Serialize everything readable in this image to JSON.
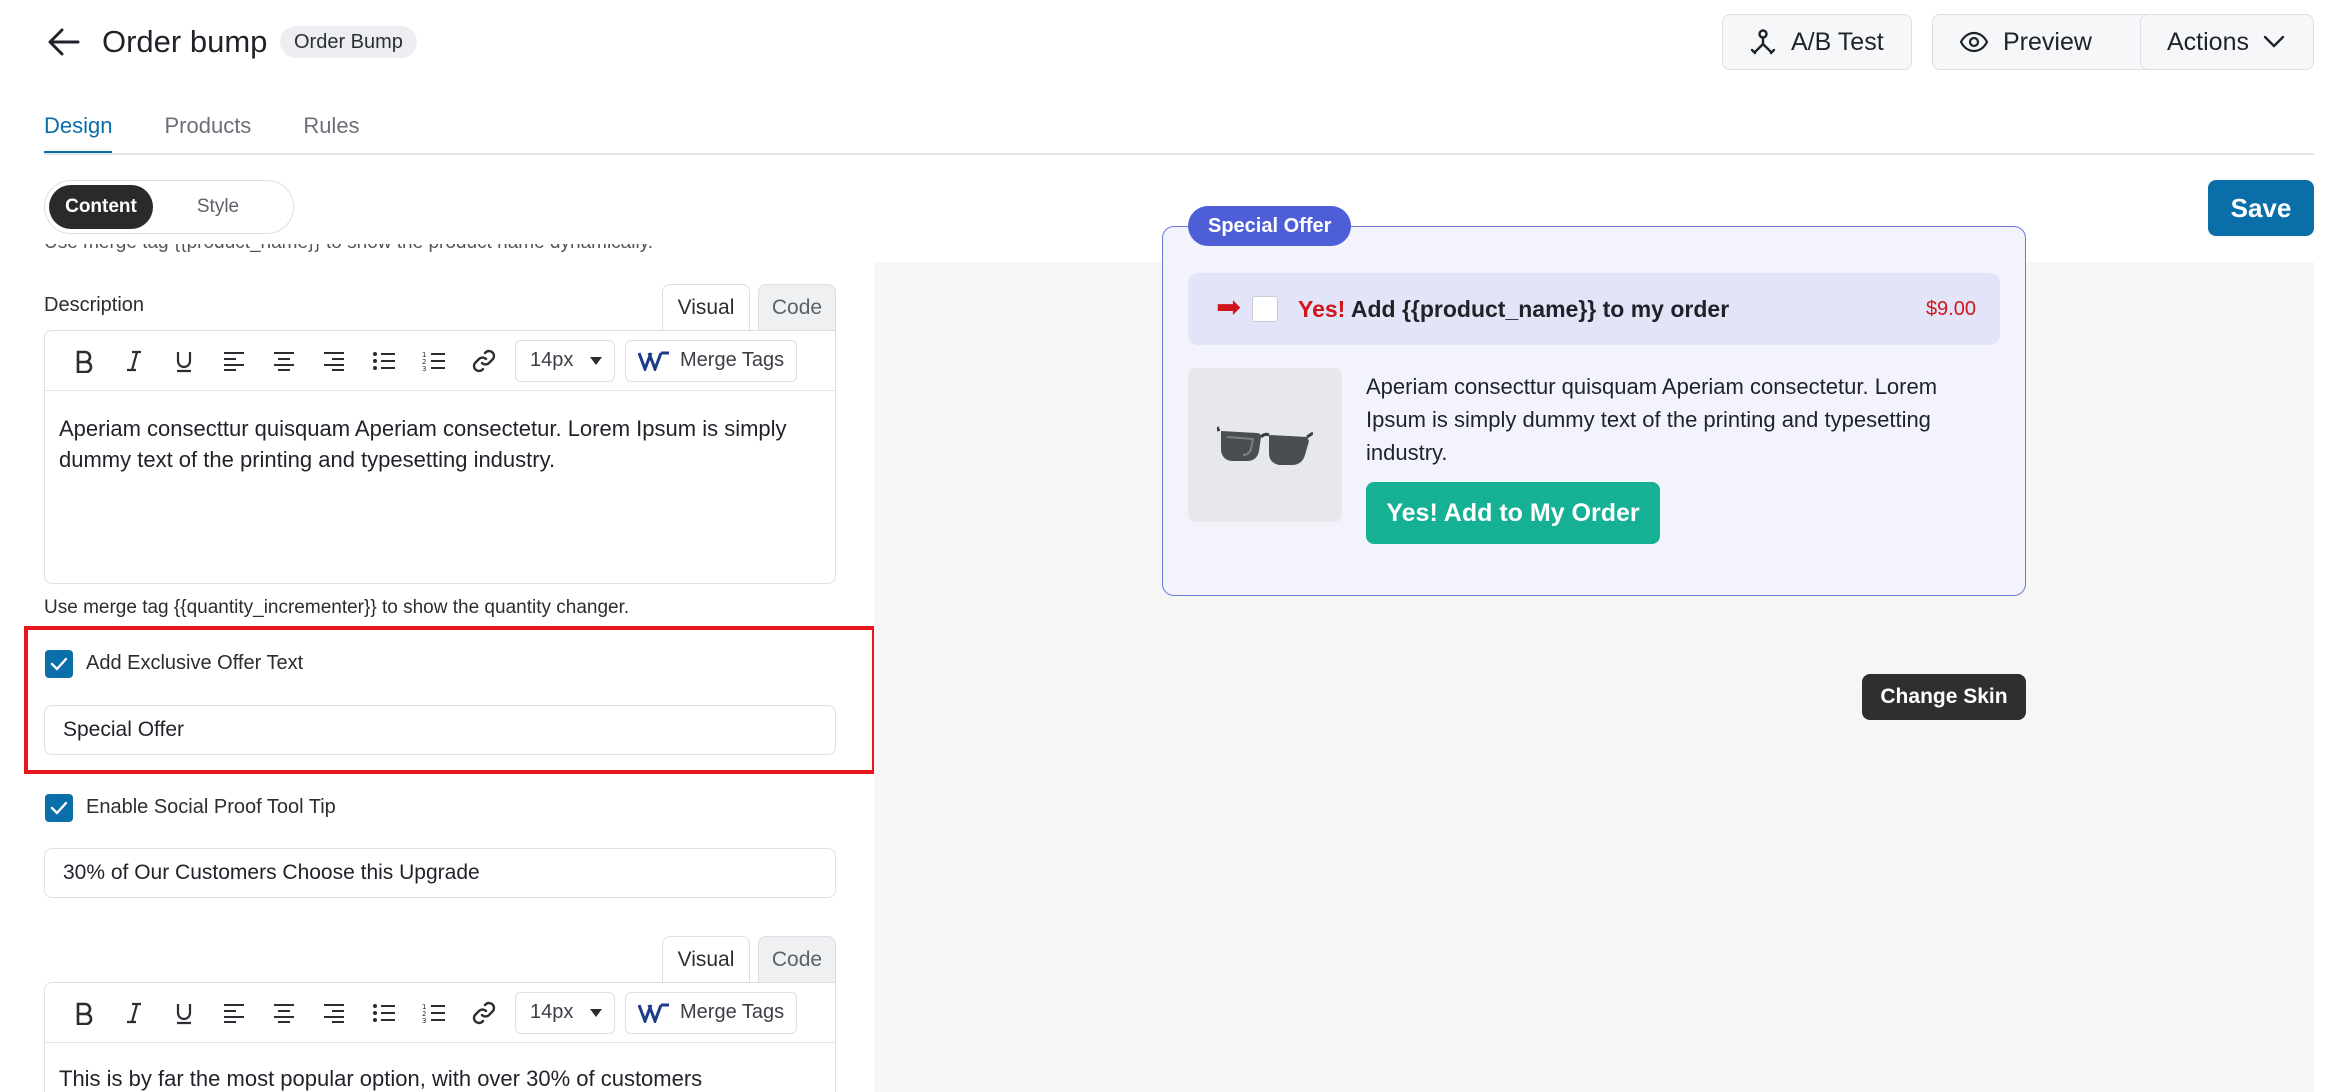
{
  "header": {
    "title": "Order bump",
    "badge": "Order Bump",
    "ab_test_label": "A/B Test",
    "preview_label": "Preview",
    "actions_label": "Actions",
    "icons": [
      "back-arrow-icon",
      "ab-test-icon",
      "eye-icon",
      "chevron-down-icon"
    ]
  },
  "tabs": [
    {
      "label": "Design",
      "active": true
    },
    {
      "label": "Products",
      "active": false
    },
    {
      "label": "Rules",
      "active": false
    }
  ],
  "mode_toggle": {
    "content": "Content",
    "style": "Style",
    "selected": "Content"
  },
  "save_label": "Save",
  "editor": {
    "cut_off_text": "Use merge tag {{product_name}} to show the product name dynamically.",
    "description_label": "Description",
    "visual_tab": "Visual",
    "code_tab": "Code",
    "font_size": "14px",
    "merge_tags_label": "Merge Tags",
    "description_text": "Aperiam consecttur quisquam Aperiam consectetur. Lorem Ipsum is simply dummy text of the printing and typesetting industry.",
    "help_text": "Use merge tag {{quantity_incrementer}} to show the quantity changer.",
    "exclusive_offer_label": "Add Exclusive Offer Text",
    "exclusive_offer_checked": true,
    "exclusive_offer_value": "Special Offer",
    "social_proof_label": "Enable Social Proof Tool Tip",
    "social_proof_checked": true,
    "social_proof_value": "30% of Our Customers Choose this Upgrade",
    "tooltip_text": "This is by far the most popular option, with over 30% of customers"
  },
  "preview": {
    "pill": "Special Offer",
    "yes_word": "Yes!",
    "row_text": " Add {{product_name}} to my order",
    "price": "$9.00",
    "description": "Aperiam consecttur quisquam Aperiam consectetur. Lorem Ipsum is simply dummy text of the printing and typesetting industry.",
    "cta": "Yes! Add to My Order",
    "change_skin": "Change Skin",
    "accent_color": "#4e5ed6",
    "cta_color": "#16b195"
  },
  "colors": {
    "primary": "#0a6ea8",
    "highlight": "#e8151c"
  }
}
